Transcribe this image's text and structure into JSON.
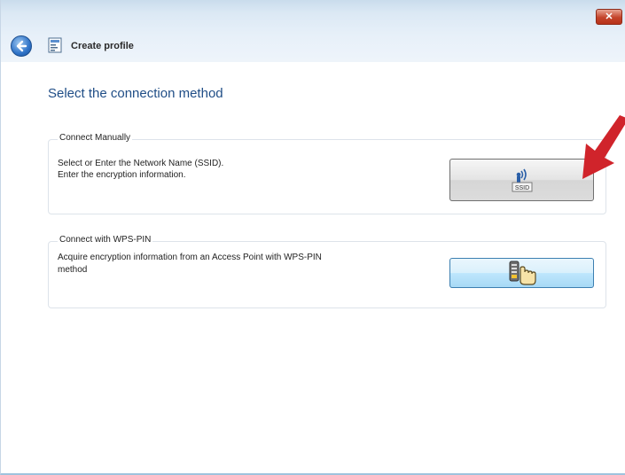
{
  "window": {
    "title": "Create profile",
    "close_label": "✕"
  },
  "page": {
    "heading": "Select the connection method"
  },
  "groups": [
    {
      "legend": "Connect Manually",
      "lines": [
        "Select or Enter the Network Name (SSID).",
        "Enter the encryption information."
      ],
      "button_caption": "SSID"
    },
    {
      "legend": "Connect with WPS-PIN",
      "lines": [
        "Acquire encryption information from an Access Point with WPS-PIN",
        "method"
      ]
    }
  ],
  "icons": {
    "back": "back-arrow-icon",
    "profile": "profile-icon",
    "ssid": "ssid-signal-icon",
    "wps": "hand-pointer-icon",
    "annotation": "red-arrow-icon"
  },
  "colors": {
    "heading": "#1f4d86",
    "annotation_arrow": "#d0242b",
    "titlebar": "#dbe8f4"
  }
}
